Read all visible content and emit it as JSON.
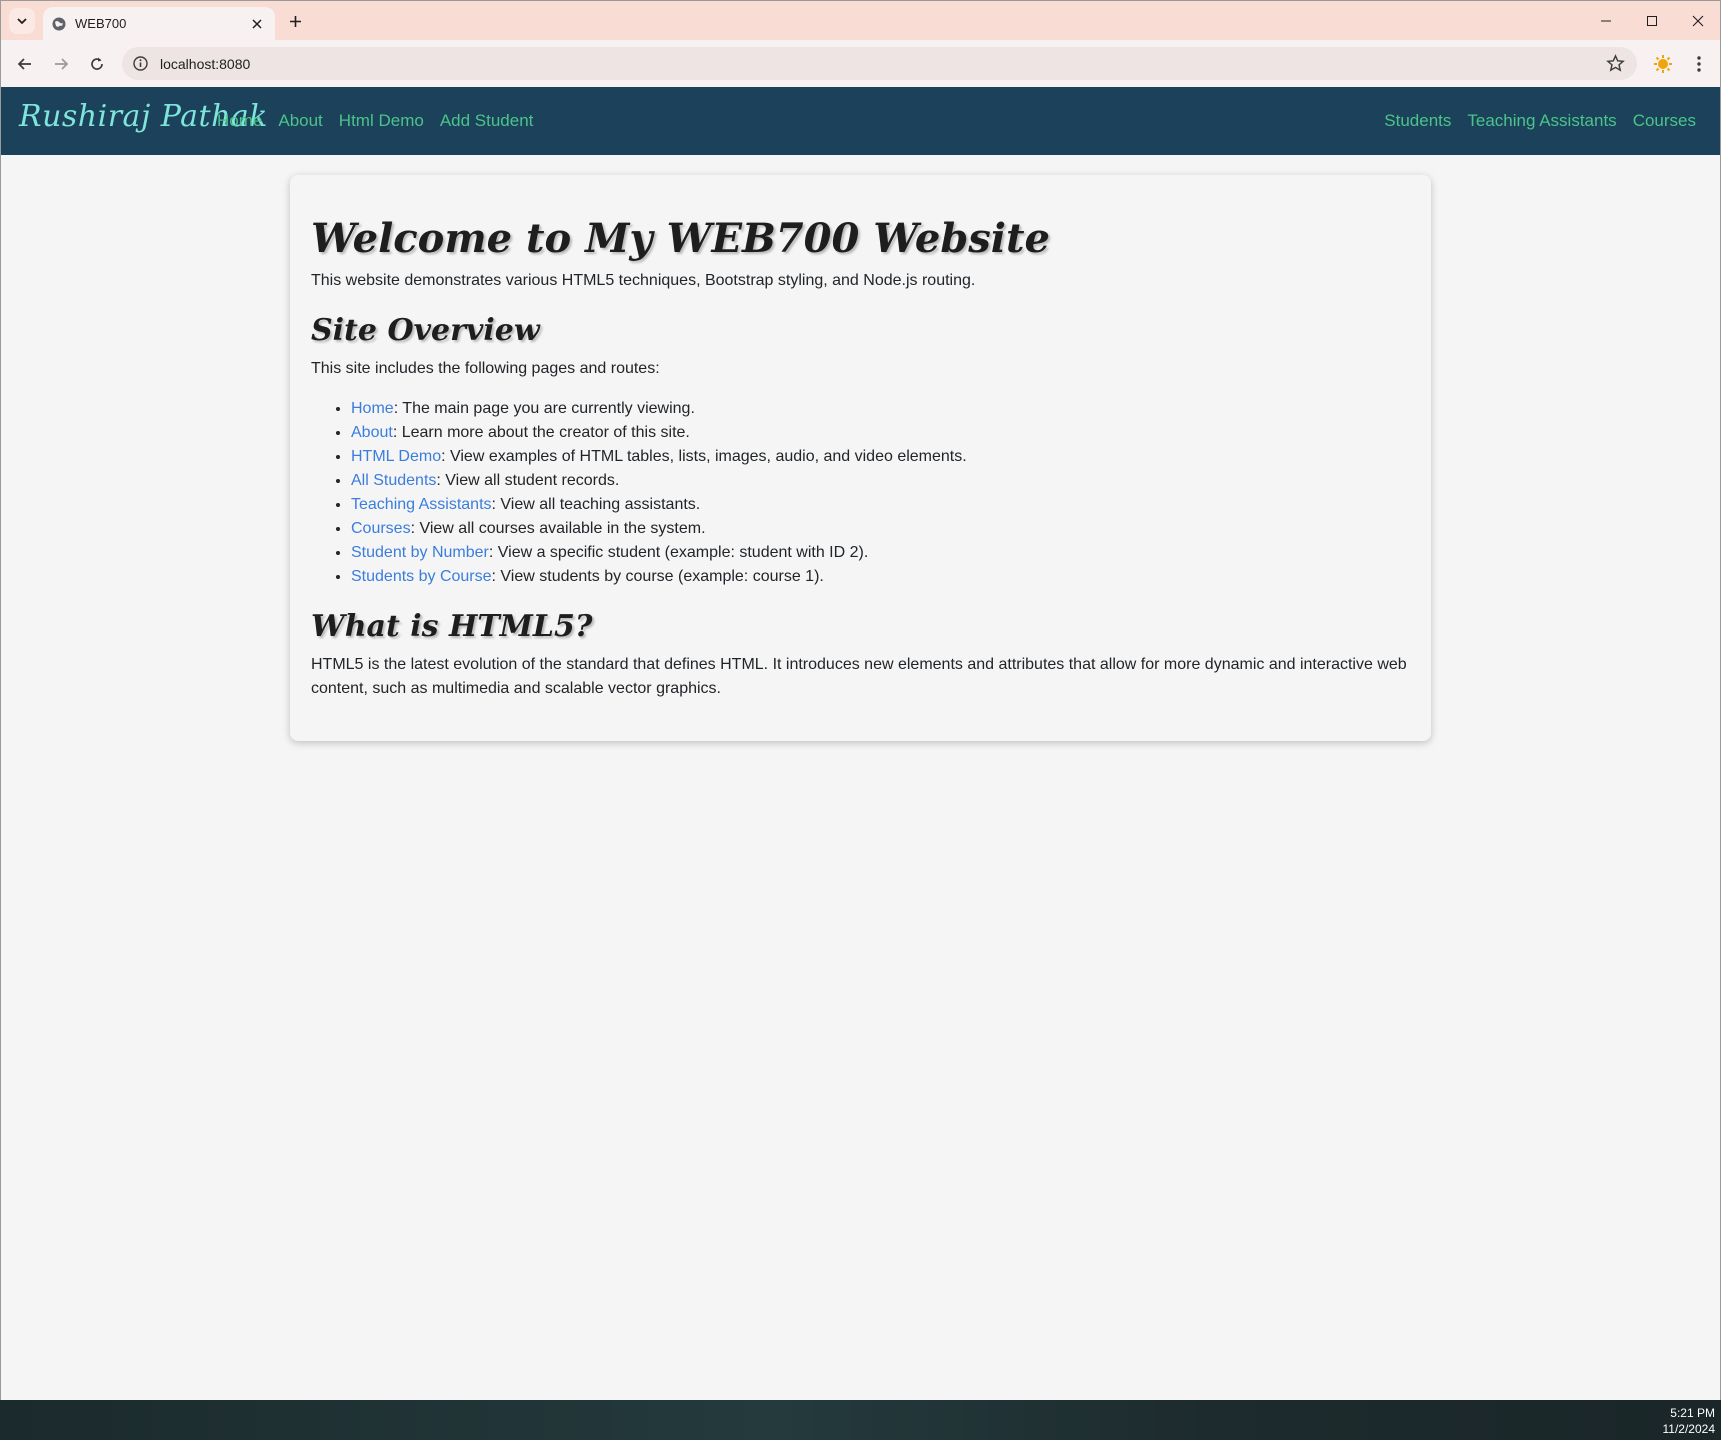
{
  "browser": {
    "tab_title": "WEB700",
    "url": "localhost:8080",
    "icons": {
      "tab_search": "chevron-down-icon",
      "favicon": "globe-icon",
      "tab_close": "close-icon",
      "new_tab": "plus-icon",
      "back": "arrow-left-icon",
      "forward": "arrow-right-icon",
      "reload": "reload-icon",
      "site_info": "info-icon",
      "bookmark": "star-icon",
      "extension": "extension-sun-icon",
      "menu": "kebab-menu-icon",
      "minimize": "minimize-icon",
      "maximize": "maximize-icon",
      "close": "close-window-icon"
    }
  },
  "navbar": {
    "brand": "Rushiraj Pathak",
    "left_links": [
      "Home",
      "About",
      "Html Demo",
      "Add Student"
    ],
    "right_links": [
      "Students",
      "Teaching Assistants",
      "Courses"
    ],
    "colors": {
      "background": "#1b425a",
      "brand": "#7fe5db",
      "link": "#4cc38a"
    }
  },
  "content": {
    "title": "Welcome to My WEB700 Website",
    "intro": "This website demonstrates various HTML5 techniques, Bootstrap styling, and Node.js routing.",
    "overview_heading": "Site Overview",
    "overview_text": "This site includes the following pages and routes:",
    "routes": [
      {
        "link": "Home",
        "desc": ": The main page you are currently viewing."
      },
      {
        "link": "About",
        "desc": ": Learn more about the creator of this site."
      },
      {
        "link": "HTML Demo",
        "desc": ": View examples of HTML tables, lists, images, audio, and video elements."
      },
      {
        "link": "All Students",
        "desc": ": View all student records."
      },
      {
        "link": "Teaching Assistants",
        "desc": ": View all teaching assistants."
      },
      {
        "link": "Courses",
        "desc": ": View all courses available in the system."
      },
      {
        "link": "Student by Number",
        "desc": ": View a specific student (example: student with ID 2)."
      },
      {
        "link": "Students by Course",
        "desc": ": View students by course (example: course 1)."
      }
    ],
    "html5_heading": "What is HTML5?",
    "html5_text": "HTML5 is the latest evolution of the standard that defines HTML. It introduces new elements and attributes that allow for more dynamic and interactive web content, such as multimedia and scalable vector graphics.",
    "link_color": "#3b7ddd"
  },
  "taskbar": {
    "time": "5:21 PM",
    "date": "11/2/2024"
  }
}
